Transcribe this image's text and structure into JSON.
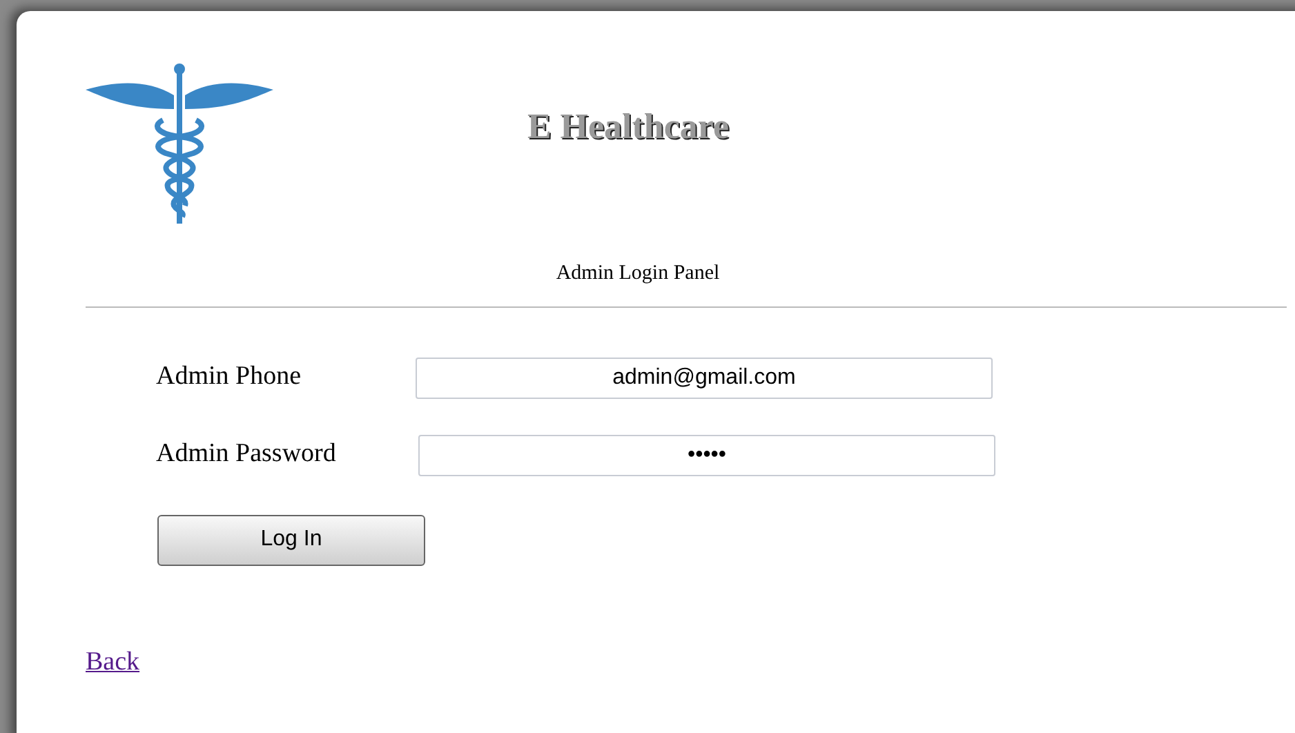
{
  "header": {
    "title": "E Healthcare",
    "subtitle": "Admin Login Panel"
  },
  "fields": [
    {
      "label": "Admin Phone",
      "value": "admin@gmail.com"
    },
    {
      "label": "Admin Password",
      "value": "•••••"
    }
  ],
  "button": "Log In",
  "back_link": "Back"
}
